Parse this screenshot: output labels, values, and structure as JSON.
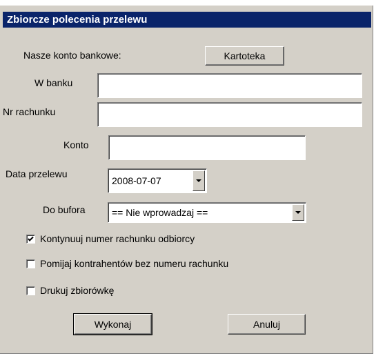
{
  "dialog": {
    "title": "Zbiorcze polecenia przelewu"
  },
  "bank": {
    "label": "Nasze konto bankowe:",
    "kartoteka_button": "Kartoteka",
    "w_banku_label": "W banku",
    "w_banku_value": "",
    "nr_rachunku_label": "Nr rachunku",
    "nr_rachunku_value": "",
    "konto_label": "Konto",
    "konto_value": ""
  },
  "transfer": {
    "data_label": "Data przelewu",
    "data_value": "2008-07-07",
    "bufor_label": "Do bufora",
    "bufor_value": "== Nie wprowadzaj =="
  },
  "options": [
    {
      "label": "Kontynuuj numer rachunku odbiorcy",
      "checked": true
    },
    {
      "label": "Pomijaj kontrahentów bez numeru rachunku",
      "checked": false
    },
    {
      "label": "Drukuj zbiorówkę",
      "checked": false
    }
  ],
  "buttons": {
    "execute": "Wykonaj",
    "cancel": "Anuluj"
  }
}
